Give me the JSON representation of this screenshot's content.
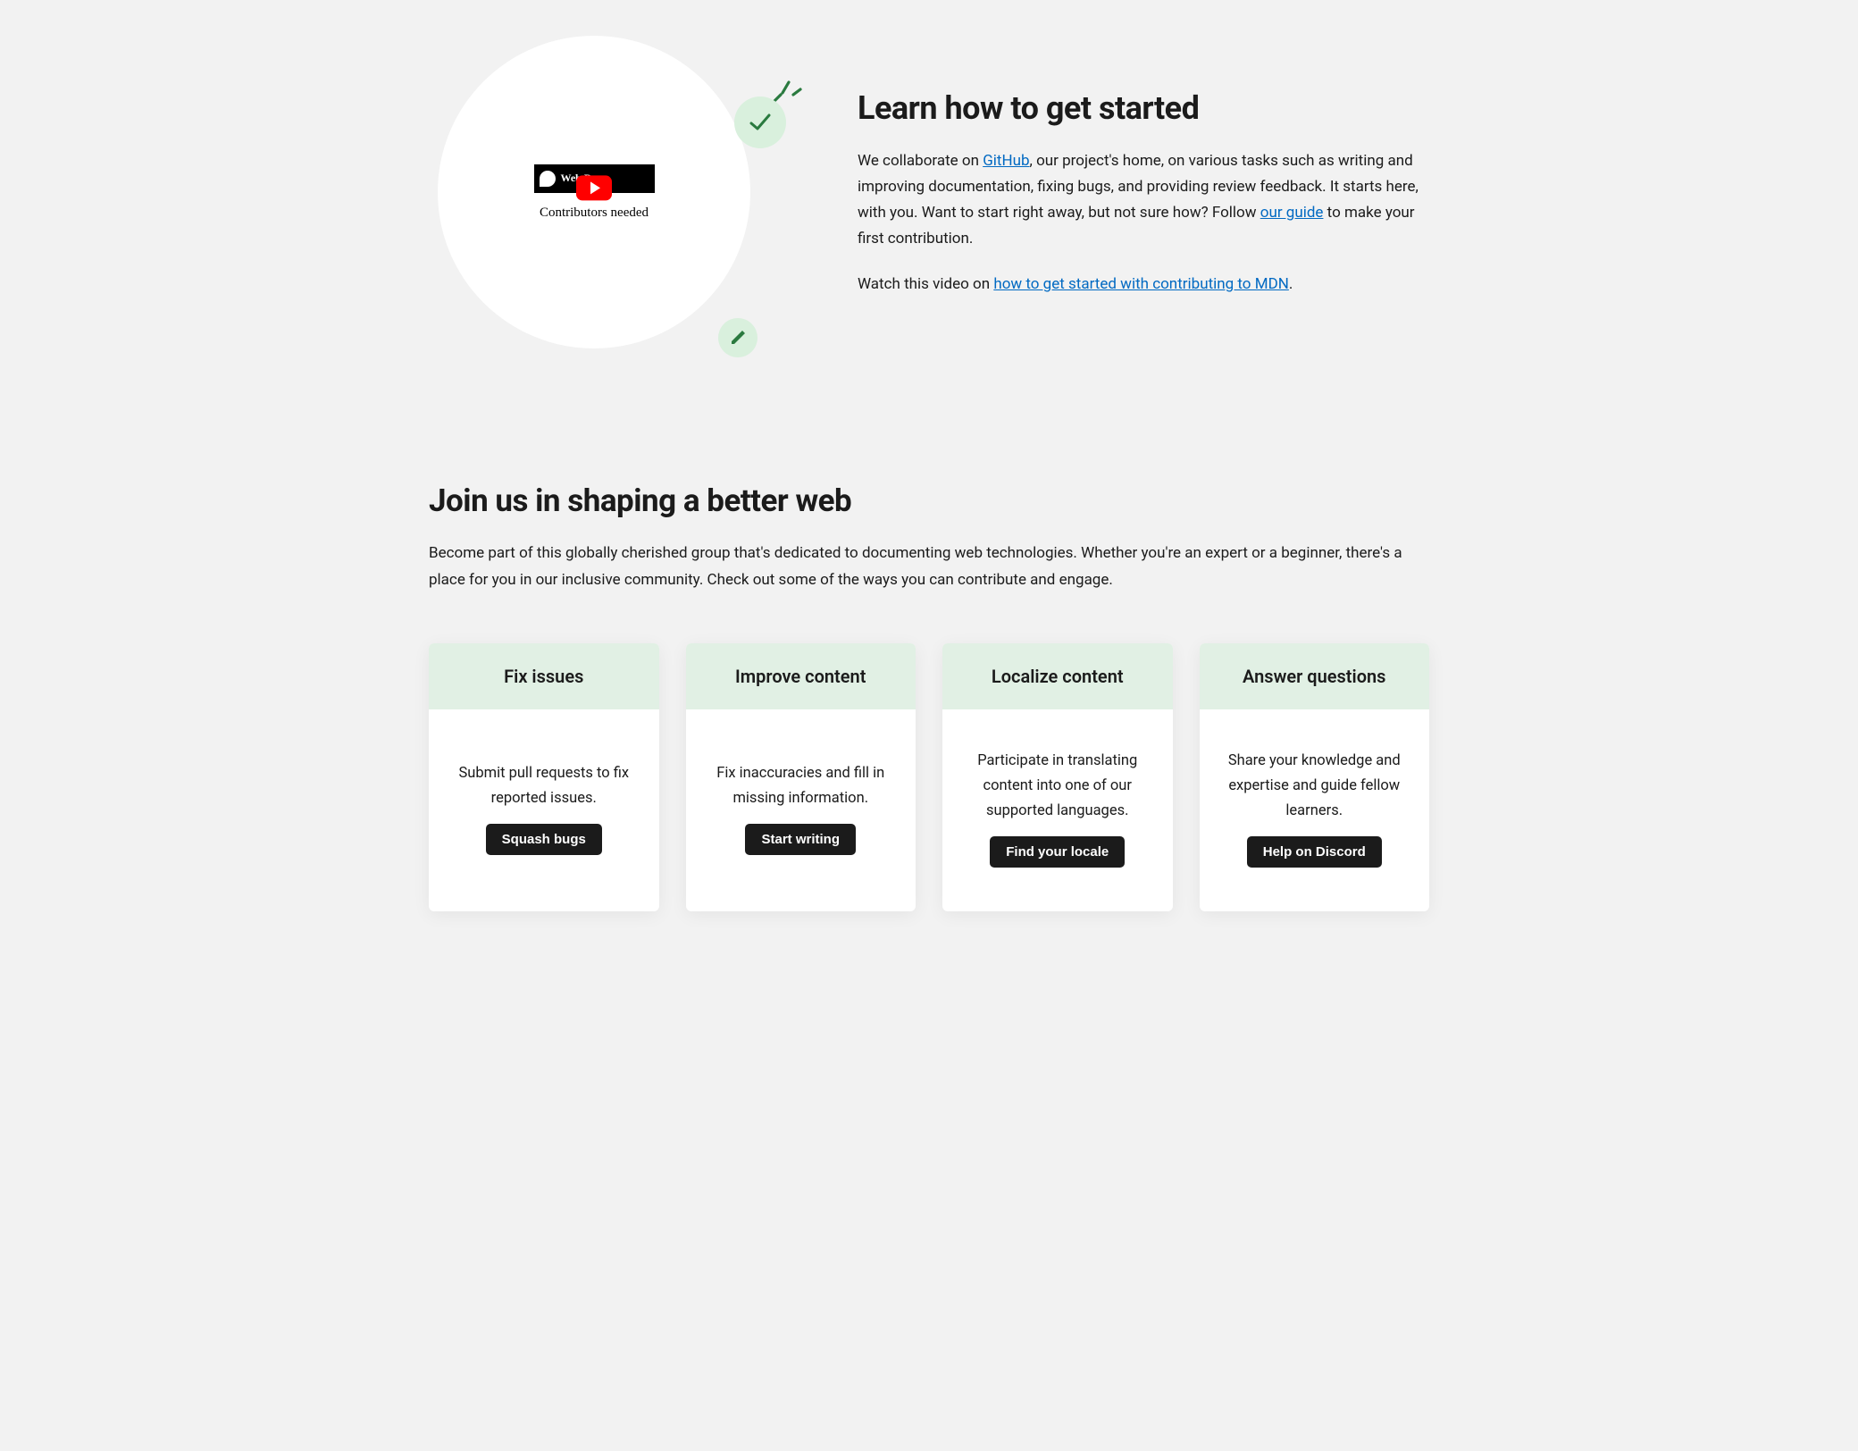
{
  "hero": {
    "graphic": {
      "video_label": "Web Docs",
      "subtitle": "Contributors needed"
    },
    "heading": "Learn how to get started",
    "para1_pre": "We collaborate on ",
    "para1_link1": "GitHub",
    "para1_mid": ", our project's home, on various tasks such as writing and improving documentation, fixing bugs, and providing review feedback. It starts here, with you. Want to start right away, but not sure how? Follow ",
    "para1_link2": "our guide",
    "para1_post": " to make your first contribution.",
    "para2_pre": "Watch this video on ",
    "para2_link": "how to get started with contributing to MDN",
    "para2_post": "."
  },
  "join": {
    "heading": "Join us in shaping a better web",
    "intro": "Become part of this globally cherished group that's dedicated to documenting web technologies. Whether you're an expert or a beginner, there's a place for you in our inclusive community. Check out some of the ways you can contribute and engage."
  },
  "cards": [
    {
      "title": "Fix issues",
      "desc": "Submit pull requests to fix reported issues.",
      "button": "Squash bugs"
    },
    {
      "title": "Improve content",
      "desc": "Fix inaccuracies and fill in missing information.",
      "button": "Start writing"
    },
    {
      "title": "Localize content",
      "desc": "Participate in translating content into one of our supported languages.",
      "button": "Find your locale"
    },
    {
      "title": "Answer questions",
      "desc": "Share your knowledge and expertise and guide fellow learners.",
      "button": "Help on Discord"
    }
  ]
}
